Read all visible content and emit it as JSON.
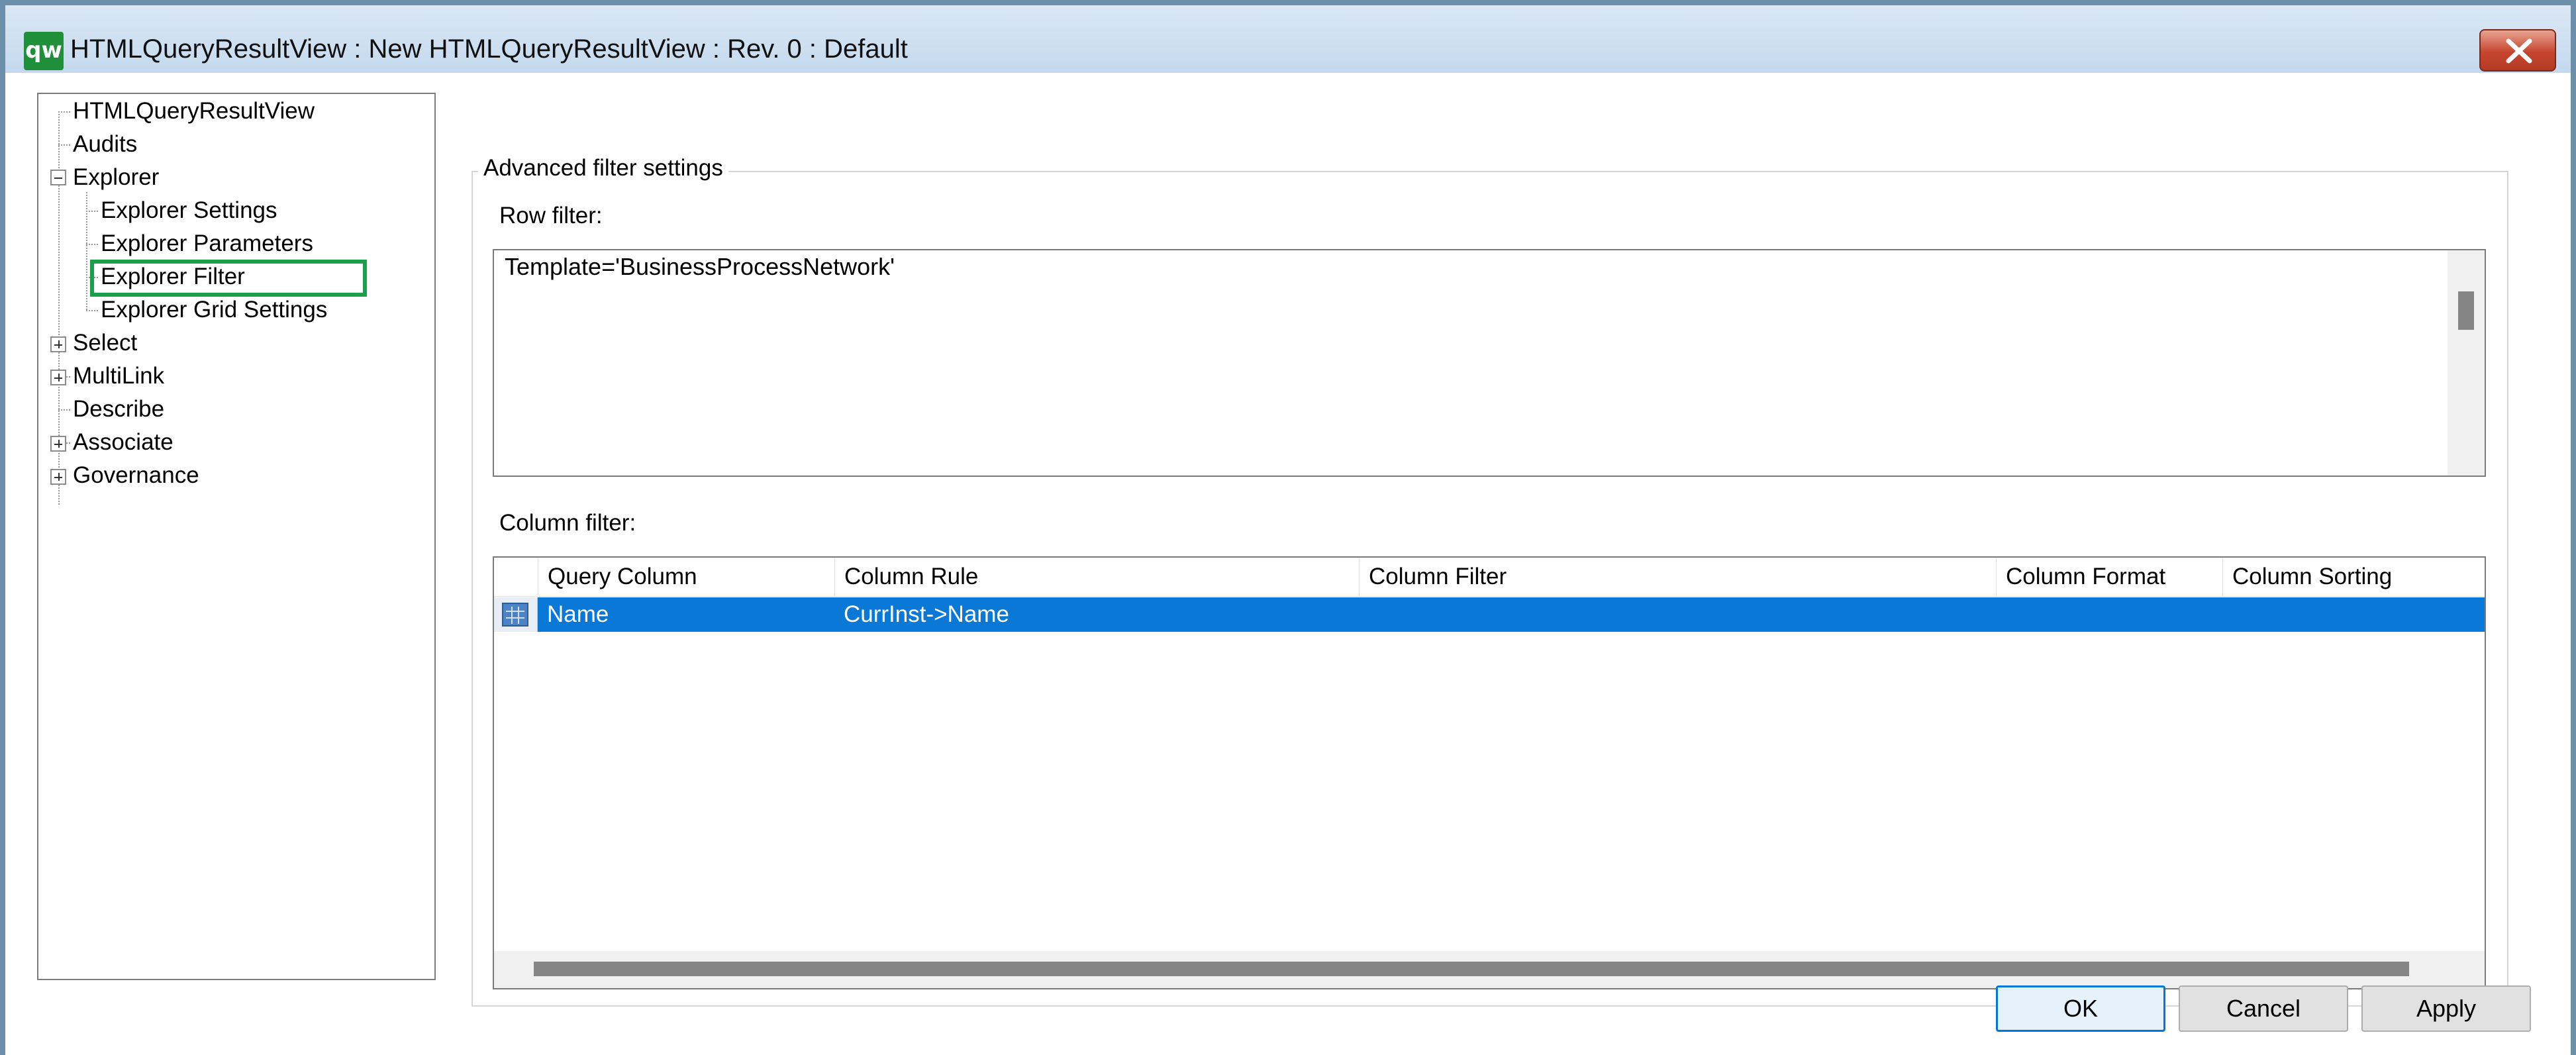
{
  "window": {
    "title": "HTMLQueryResultView : New HTMLQueryResultView : Rev. 0  : Default",
    "app_icon_text": "qw",
    "accent_color": "#0a78d7",
    "highlight_color": "#1aa04a"
  },
  "tree": {
    "items": [
      {
        "label": "HTMLQueryResultView",
        "expander": "none",
        "level": 0
      },
      {
        "label": "Audits",
        "expander": "none",
        "level": 0
      },
      {
        "label": "Explorer",
        "expander": "minus",
        "level": 0
      },
      {
        "label": "Explorer Settings",
        "expander": "none",
        "level": 1
      },
      {
        "label": "Explorer Parameters",
        "expander": "none",
        "level": 1
      },
      {
        "label": "Explorer Filter",
        "expander": "none",
        "level": 1,
        "highlighted": true
      },
      {
        "label": "Explorer Grid Settings",
        "expander": "none",
        "level": 1
      },
      {
        "label": "Select",
        "expander": "plus",
        "level": 0
      },
      {
        "label": "MultiLink",
        "expander": "plus",
        "level": 0
      },
      {
        "label": "Describe",
        "expander": "none",
        "level": 0
      },
      {
        "label": "Associate",
        "expander": "plus",
        "level": 0
      },
      {
        "label": "Governance",
        "expander": "plus",
        "level": 0
      }
    ]
  },
  "advanced": {
    "group_label": "Advanced filter settings",
    "row_filter_label": "Row filter:",
    "row_filter_value": "Template='BusinessProcessNetwork'",
    "column_filter_label": "Column filter:",
    "columns": [
      "Query Column",
      "Column Rule",
      "Column Filter",
      "Column Format",
      "Column Sorting"
    ],
    "rows": [
      [
        "Name",
        "CurrInst->Name",
        "",
        "",
        ""
      ]
    ]
  },
  "buttons": {
    "ok": "OK",
    "cancel": "Cancel",
    "apply": "Apply"
  }
}
